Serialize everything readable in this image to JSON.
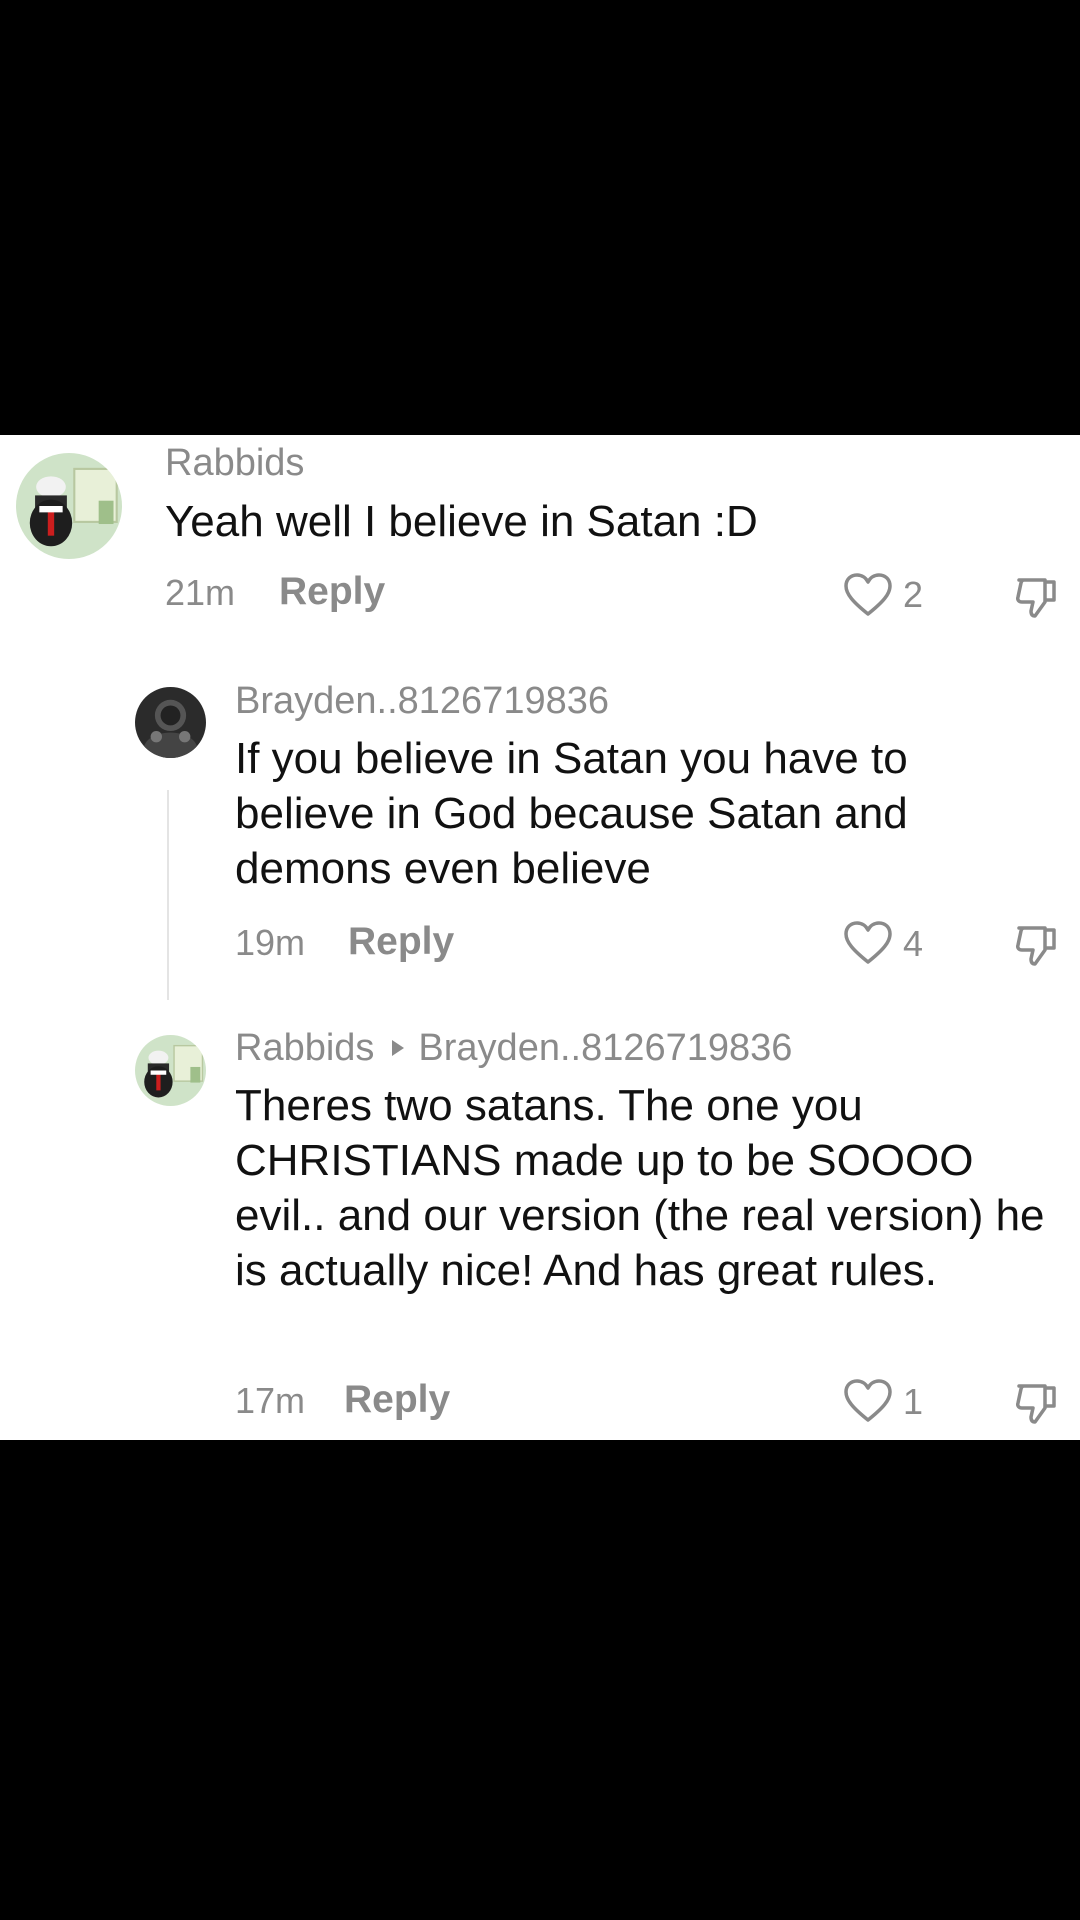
{
  "comments": [
    {
      "username": "Rabbids",
      "text": "Yeah well I believe in Satan :D",
      "time": "21m",
      "reply_label": "Reply",
      "likes": "2",
      "avatar_icon": "rabbid-avatar"
    },
    {
      "username": "Brayden..8126719836",
      "text": "If you believe in Satan you have to believe in God because Satan and demons even believe",
      "time": "19m",
      "reply_label": "Reply",
      "likes": "4",
      "avatar_icon": "dark-avatar"
    },
    {
      "username": "Rabbids",
      "reply_to": "Brayden..8126719836",
      "text": "Theres two satans. The one you CHRISTIANS made up to be SOOOO evil.. and our version (the real version) he is actually nice! And has great rules.",
      "time": "17m",
      "reply_label": "Reply",
      "likes": "1",
      "avatar_icon": "rabbid-avatar"
    }
  ],
  "colors": {
    "background": "#000000",
    "panel": "#ffffff",
    "muted": "#8a8a8a",
    "text": "#111111"
  }
}
